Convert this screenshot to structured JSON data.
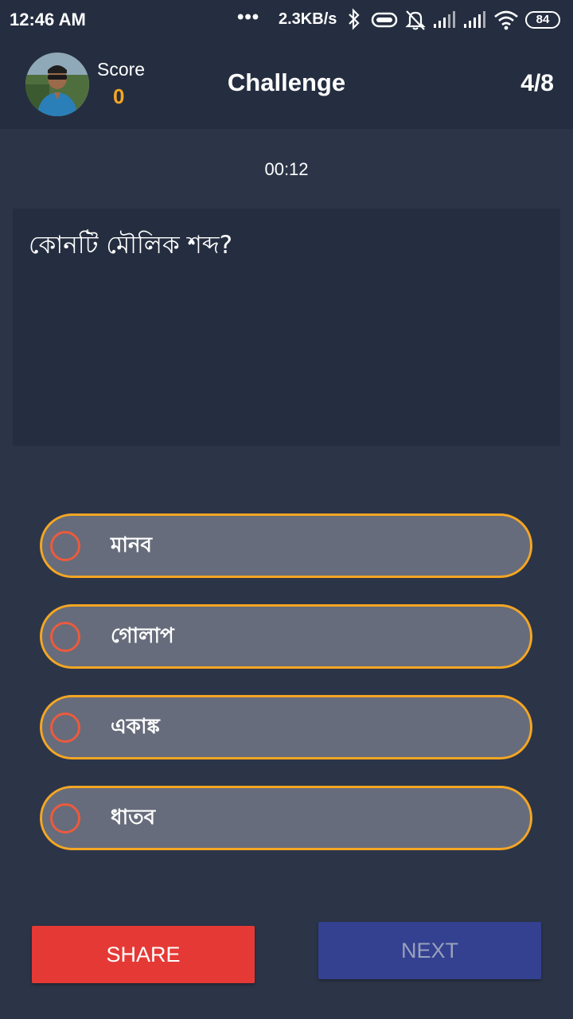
{
  "status_bar": {
    "time": "12:46 AM",
    "dots": "•••",
    "network_speed": "2.3KB/s",
    "battery": "84",
    "icons": [
      "bluetooth-icon",
      "eye-comfort-icon",
      "alarm-off-icon",
      "signal-icon",
      "signal-icon",
      "wifi-icon",
      "battery-icon"
    ]
  },
  "header": {
    "score_label": "Score",
    "score_value": "0",
    "title": "Challenge",
    "progress": "4/8"
  },
  "timer": "00:12",
  "question": {
    "text": "কোনটি মৌলিক শব্দ?"
  },
  "options": [
    {
      "label": "মানব",
      "selected": false
    },
    {
      "label": "গোলাপ",
      "selected": false
    },
    {
      "label": "একাঙ্ক",
      "selected": false
    },
    {
      "label": "ধাতব",
      "selected": false
    }
  ],
  "actions": {
    "share_label": "SHARE",
    "next_label": "NEXT"
  },
  "colors": {
    "background": "#2c3548",
    "header_bg": "#252e40",
    "accent": "#f5a623",
    "option_bg": "#666c7b",
    "radio": "#ee5a3c",
    "share": "#e53935",
    "next": "#334190"
  }
}
